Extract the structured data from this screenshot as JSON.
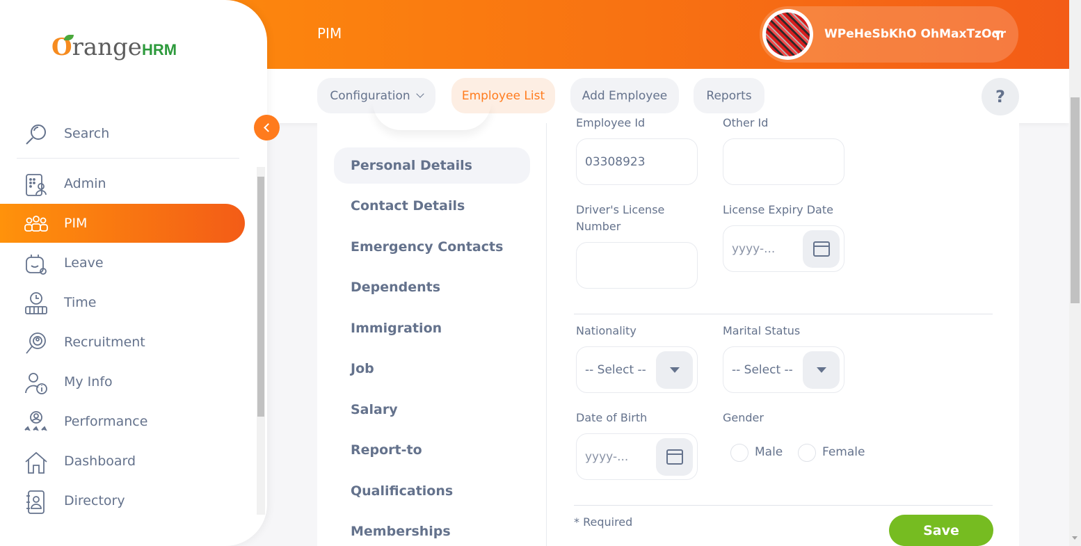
{
  "header": {
    "module_title": "PIM",
    "user_name": "WPeHeSbKhO OhMaxTzOqr"
  },
  "top_nav": {
    "items": [
      {
        "label": "Configuration"
      },
      {
        "label": "Employee List"
      },
      {
        "label": "Add Employee"
      },
      {
        "label": "Reports"
      }
    ],
    "help_label": "?"
  },
  "sidebar": {
    "brand_prefix": "O",
    "brand_main": "range",
    "brand_suffix": "HRM",
    "search_label": "Search",
    "items": [
      {
        "label": "Admin",
        "icon": "admin-icon"
      },
      {
        "label": "PIM",
        "icon": "pim-icon"
      },
      {
        "label": "Leave",
        "icon": "leave-icon"
      },
      {
        "label": "Time",
        "icon": "time-icon"
      },
      {
        "label": "Recruitment",
        "icon": "recruitment-icon"
      },
      {
        "label": "My Info",
        "icon": "my-info-icon"
      },
      {
        "label": "Performance",
        "icon": "performance-icon"
      },
      {
        "label": "Dashboard",
        "icon": "dashboard-icon"
      },
      {
        "label": "Directory",
        "icon": "directory-icon"
      }
    ],
    "active_item": "PIM"
  },
  "tabs": {
    "items": [
      {
        "label": "Personal Details"
      },
      {
        "label": "Contact Details"
      },
      {
        "label": "Emergency Contacts"
      },
      {
        "label": "Dependents"
      },
      {
        "label": "Immigration"
      },
      {
        "label": "Job"
      },
      {
        "label": "Salary"
      },
      {
        "label": "Report-to"
      },
      {
        "label": "Qualifications"
      },
      {
        "label": "Memberships"
      }
    ],
    "active": "Personal Details"
  },
  "form": {
    "employee_id_label": "Employee Id",
    "employee_id_value": "03308923",
    "other_id_label": "Other Id",
    "other_id_value": "",
    "drivers_license_label_line1": "Driver's License",
    "drivers_license_label_line2": "Number",
    "drivers_license_value": "",
    "license_expiry_label": "License Expiry Date",
    "license_expiry_placeholder": "yyyy-...",
    "nationality_label": "Nationality",
    "nationality_value": "-- Select --",
    "marital_status_label": "Marital Status",
    "marital_status_value": "-- Select --",
    "dob_label": "Date of Birth",
    "dob_placeholder": "yyyy-...",
    "gender_label": "Gender",
    "gender_options": [
      "Male",
      "Female"
    ],
    "required_note": "* Required",
    "save_label": "Save"
  },
  "colors": {
    "brand_orange": "#ff7b1d",
    "header_gradient_start": "#ff920b",
    "header_gradient_end": "#f35c17",
    "save_green": "#76bc21",
    "text": "#64728c"
  }
}
